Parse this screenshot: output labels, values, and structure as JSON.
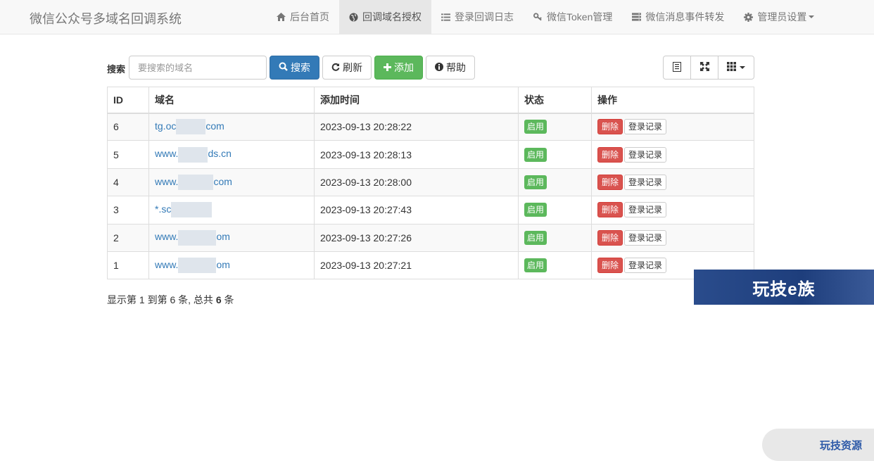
{
  "brand": "微信公众号多域名回调系统",
  "nav": [
    {
      "icon": "home-icon",
      "label": "后台首页",
      "active": false
    },
    {
      "icon": "globe-icon",
      "label": "回调域名授权",
      "active": true
    },
    {
      "icon": "list-icon",
      "label": "登录回调日志",
      "active": false
    },
    {
      "icon": "key-icon",
      "label": "微信Token管理",
      "active": false
    },
    {
      "icon": "server-icon",
      "label": "微信消息事件转发",
      "active": false
    },
    {
      "icon": "gear-icon",
      "label": "管理员设置",
      "active": false
    }
  ],
  "toolbar": {
    "search_label": "搜索",
    "search_placeholder": "要搜索的域名",
    "search_button": "搜索",
    "refresh_button": "刷新",
    "add_button": "添加",
    "help_button": "帮助"
  },
  "table": {
    "headers": [
      "ID",
      "域名",
      "添加时间",
      "状态",
      "操作"
    ],
    "rows": [
      {
        "id": "6",
        "domain_pre": "tg.oc",
        "domain_post": "com",
        "time": "2023-09-13 20:28:22",
        "status": "启用"
      },
      {
        "id": "5",
        "domain_pre": "www.",
        "domain_post": "ds.cn",
        "time": "2023-09-13 20:28:13",
        "status": "启用"
      },
      {
        "id": "4",
        "domain_pre": "www.",
        "domain_post": "com",
        "time": "2023-09-13 20:28:00",
        "status": "启用"
      },
      {
        "id": "3",
        "domain_pre": "*.sc",
        "domain_post": "",
        "time": "2023-09-13 20:27:43",
        "status": "启用"
      },
      {
        "id": "2",
        "domain_pre": "www.",
        "domain_post": "om",
        "time": "2023-09-13 20:27:26",
        "status": "启用"
      },
      {
        "id": "1",
        "domain_pre": "www.",
        "domain_post": "om",
        "time": "2023-09-13 20:27:21",
        "status": "启用"
      }
    ],
    "delete_label": "删除",
    "log_label": "登录记录"
  },
  "pagination": {
    "prefix": "显示第",
    "from": "1",
    "mid": "到第",
    "to": "6",
    "suffix1": "条, 总共",
    "total": "6",
    "suffix2": "条"
  },
  "watermark": "玩技e族",
  "corner_mark": "玩技资源"
}
